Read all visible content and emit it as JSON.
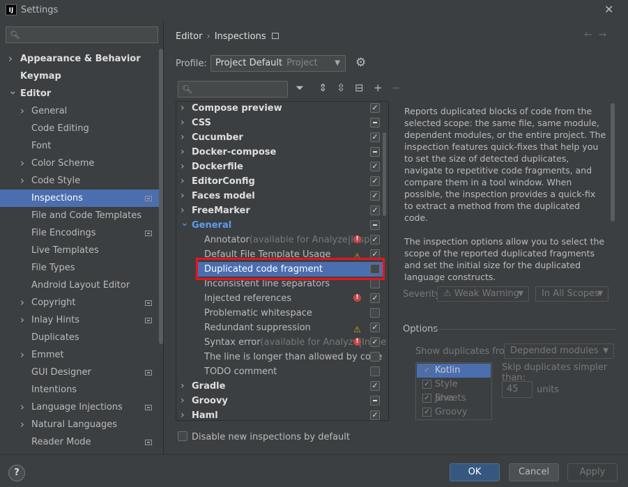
{
  "window": {
    "title": "Settings",
    "close_icon": "close-icon"
  },
  "left": {
    "search_placeholder": "",
    "items": [
      {
        "label": "Appearance & Behavior",
        "bold": true,
        "chevron": "right"
      },
      {
        "label": "Keymap",
        "bold": true
      },
      {
        "label": "Editor",
        "bold": true,
        "chevron": "down"
      },
      {
        "label": "General",
        "chevron": "right"
      },
      {
        "label": "Code Editing"
      },
      {
        "label": "Font"
      },
      {
        "label": "Color Scheme",
        "chevron": "right"
      },
      {
        "label": "Code Style",
        "chevron": "right"
      },
      {
        "label": "Inspections",
        "selected": true,
        "badge": true
      },
      {
        "label": "File and Code Templates"
      },
      {
        "label": "File Encodings",
        "badge": true
      },
      {
        "label": "Live Templates"
      },
      {
        "label": "File Types"
      },
      {
        "label": "Android Layout Editor"
      },
      {
        "label": "Copyright",
        "chevron": "right",
        "badge": true
      },
      {
        "label": "Inlay Hints",
        "chevron": "right",
        "badge": true
      },
      {
        "label": "Duplicates"
      },
      {
        "label": "Emmet",
        "chevron": "right"
      },
      {
        "label": "GUI Designer",
        "badge": true
      },
      {
        "label": "Intentions"
      },
      {
        "label": "Language Injections",
        "chevron": "right",
        "badge": true
      },
      {
        "label": "Natural Languages",
        "chevron": "right"
      },
      {
        "label": "Reader Mode",
        "badge": true
      }
    ]
  },
  "breadcrumb": {
    "part1": "Editor",
    "sep": "›",
    "part2": "Inspections"
  },
  "profile": {
    "label": "Profile:",
    "value": "Project Default",
    "sub": "Project"
  },
  "tree": [
    {
      "label": "Compose preview",
      "level": 0,
      "chev": "›",
      "cb": "check"
    },
    {
      "label": "CSS",
      "level": 0,
      "chev": "›",
      "cb": "dash"
    },
    {
      "label": "Cucumber",
      "level": 0,
      "chev": "›",
      "cb": "check"
    },
    {
      "label": "Docker-compose",
      "level": 0,
      "chev": "›",
      "cb": "dash"
    },
    {
      "label": "Dockerfile",
      "level": 0,
      "chev": "›",
      "cb": "check"
    },
    {
      "label": "EditorConfig",
      "level": 0,
      "chev": "›",
      "cb": "check"
    },
    {
      "label": "Faces model",
      "level": 0,
      "chev": "›",
      "cb": "check"
    },
    {
      "label": "FreeMarker",
      "level": 0,
      "chev": "›",
      "cb": "check"
    },
    {
      "label": "General",
      "level": 0,
      "chev": "⌄",
      "cb": "dash",
      "expanded": true
    },
    {
      "label": "Annotator",
      "note": "(available for Analyze|Inspec",
      "level": 1,
      "cb": "check",
      "sev": "err"
    },
    {
      "label": "Default File Template Usage",
      "level": 1,
      "cb": "check",
      "sev": "warn"
    },
    {
      "label": "Duplicated code fragment",
      "level": 1,
      "cb": "none",
      "selected": true
    },
    {
      "label": "Inconsistent line separators",
      "level": 1,
      "cb": "none"
    },
    {
      "label": "Injected references",
      "level": 1,
      "cb": "check",
      "sev": "err"
    },
    {
      "label": "Problematic whitespace",
      "level": 1,
      "cb": "none"
    },
    {
      "label": "Redundant suppression",
      "level": 1,
      "cb": "check",
      "sev": "warn"
    },
    {
      "label": "Syntax error",
      "note": "(available for Analyze|Inspe",
      "level": 1,
      "cb": "check",
      "sev": "err"
    },
    {
      "label": "The line is longer than allowed by code",
      "level": 1,
      "cb": "none"
    },
    {
      "label": "TODO comment",
      "level": 1,
      "cb": "none"
    },
    {
      "label": "Gradle",
      "level": 0,
      "chev": "›",
      "cb": "check"
    },
    {
      "label": "Groovy",
      "level": 0,
      "chev": "›",
      "cb": "dash"
    },
    {
      "label": "Haml",
      "level": 0,
      "chev": "›",
      "cb": "check"
    }
  ],
  "description": {
    "p1": "Reports duplicated blocks of code from the selected scope: the same file, same module, dependent modules, or the entire project. The inspection features quick-fixes that help you to set the size of detected duplicates, navigate to repetitive code fragments, and compare them in a tool window. When possible, the inspection provides a quick-fix to extract a method from the duplicated code.",
    "p2": "The inspection options allow you to select the scope of the reported duplicated fragments and set the initial size for the duplicated language constructs."
  },
  "severity": {
    "label": "Severity:",
    "value": "Weak Warning",
    "scope": "In All Scopes"
  },
  "options": {
    "label": "Options",
    "show_label": "Show duplicates from:",
    "show_value": "Depended modules",
    "skip_label": "Skip duplicates simpler than:",
    "skip_value": "45",
    "units": "units",
    "languages": [
      {
        "label": "Kotlin",
        "selected": true
      },
      {
        "label": "Style Sheets"
      },
      {
        "label": "Java"
      },
      {
        "label": "Groovy"
      }
    ]
  },
  "disable_new": "Disable new inspections by default",
  "buttons": {
    "ok": "OK",
    "cancel": "Cancel",
    "apply": "Apply",
    "help": "?"
  }
}
